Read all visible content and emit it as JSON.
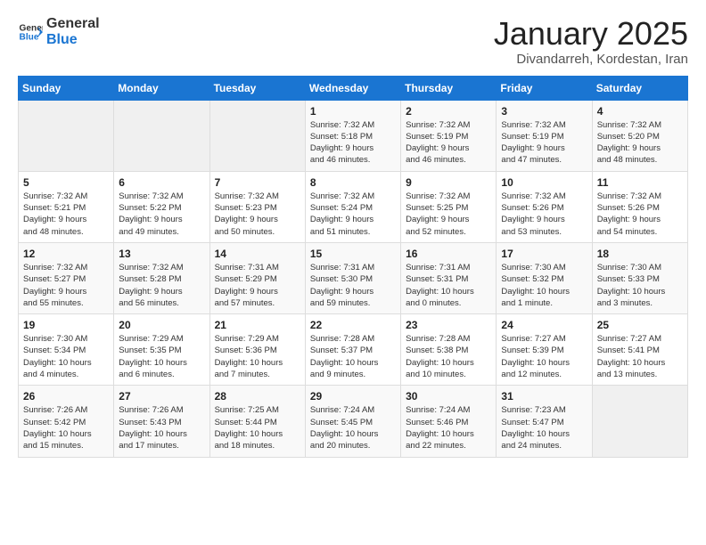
{
  "logo": {
    "line1": "General",
    "line2": "Blue"
  },
  "title": "January 2025",
  "subtitle": "Divandarreh, Kordestan, Iran",
  "weekdays": [
    "Sunday",
    "Monday",
    "Tuesday",
    "Wednesday",
    "Thursday",
    "Friday",
    "Saturday"
  ],
  "weeks": [
    [
      {
        "day": "",
        "empty": true
      },
      {
        "day": "",
        "empty": true
      },
      {
        "day": "",
        "empty": true
      },
      {
        "day": "1",
        "info": "Sunrise: 7:32 AM\nSunset: 5:18 PM\nDaylight: 9 hours\nand 46 minutes."
      },
      {
        "day": "2",
        "info": "Sunrise: 7:32 AM\nSunset: 5:19 PM\nDaylight: 9 hours\nand 46 minutes."
      },
      {
        "day": "3",
        "info": "Sunrise: 7:32 AM\nSunset: 5:19 PM\nDaylight: 9 hours\nand 47 minutes."
      },
      {
        "day": "4",
        "info": "Sunrise: 7:32 AM\nSunset: 5:20 PM\nDaylight: 9 hours\nand 48 minutes."
      }
    ],
    [
      {
        "day": "5",
        "info": "Sunrise: 7:32 AM\nSunset: 5:21 PM\nDaylight: 9 hours\nand 48 minutes."
      },
      {
        "day": "6",
        "info": "Sunrise: 7:32 AM\nSunset: 5:22 PM\nDaylight: 9 hours\nand 49 minutes."
      },
      {
        "day": "7",
        "info": "Sunrise: 7:32 AM\nSunset: 5:23 PM\nDaylight: 9 hours\nand 50 minutes."
      },
      {
        "day": "8",
        "info": "Sunrise: 7:32 AM\nSunset: 5:24 PM\nDaylight: 9 hours\nand 51 minutes."
      },
      {
        "day": "9",
        "info": "Sunrise: 7:32 AM\nSunset: 5:25 PM\nDaylight: 9 hours\nand 52 minutes."
      },
      {
        "day": "10",
        "info": "Sunrise: 7:32 AM\nSunset: 5:26 PM\nDaylight: 9 hours\nand 53 minutes."
      },
      {
        "day": "11",
        "info": "Sunrise: 7:32 AM\nSunset: 5:26 PM\nDaylight: 9 hours\nand 54 minutes."
      }
    ],
    [
      {
        "day": "12",
        "info": "Sunrise: 7:32 AM\nSunset: 5:27 PM\nDaylight: 9 hours\nand 55 minutes."
      },
      {
        "day": "13",
        "info": "Sunrise: 7:32 AM\nSunset: 5:28 PM\nDaylight: 9 hours\nand 56 minutes."
      },
      {
        "day": "14",
        "info": "Sunrise: 7:31 AM\nSunset: 5:29 PM\nDaylight: 9 hours\nand 57 minutes."
      },
      {
        "day": "15",
        "info": "Sunrise: 7:31 AM\nSunset: 5:30 PM\nDaylight: 9 hours\nand 59 minutes."
      },
      {
        "day": "16",
        "info": "Sunrise: 7:31 AM\nSunset: 5:31 PM\nDaylight: 10 hours\nand 0 minutes."
      },
      {
        "day": "17",
        "info": "Sunrise: 7:30 AM\nSunset: 5:32 PM\nDaylight: 10 hours\nand 1 minute."
      },
      {
        "day": "18",
        "info": "Sunrise: 7:30 AM\nSunset: 5:33 PM\nDaylight: 10 hours\nand 3 minutes."
      }
    ],
    [
      {
        "day": "19",
        "info": "Sunrise: 7:30 AM\nSunset: 5:34 PM\nDaylight: 10 hours\nand 4 minutes."
      },
      {
        "day": "20",
        "info": "Sunrise: 7:29 AM\nSunset: 5:35 PM\nDaylight: 10 hours\nand 6 minutes."
      },
      {
        "day": "21",
        "info": "Sunrise: 7:29 AM\nSunset: 5:36 PM\nDaylight: 10 hours\nand 7 minutes."
      },
      {
        "day": "22",
        "info": "Sunrise: 7:28 AM\nSunset: 5:37 PM\nDaylight: 10 hours\nand 9 minutes."
      },
      {
        "day": "23",
        "info": "Sunrise: 7:28 AM\nSunset: 5:38 PM\nDaylight: 10 hours\nand 10 minutes."
      },
      {
        "day": "24",
        "info": "Sunrise: 7:27 AM\nSunset: 5:39 PM\nDaylight: 10 hours\nand 12 minutes."
      },
      {
        "day": "25",
        "info": "Sunrise: 7:27 AM\nSunset: 5:41 PM\nDaylight: 10 hours\nand 13 minutes."
      }
    ],
    [
      {
        "day": "26",
        "info": "Sunrise: 7:26 AM\nSunset: 5:42 PM\nDaylight: 10 hours\nand 15 minutes."
      },
      {
        "day": "27",
        "info": "Sunrise: 7:26 AM\nSunset: 5:43 PM\nDaylight: 10 hours\nand 17 minutes."
      },
      {
        "day": "28",
        "info": "Sunrise: 7:25 AM\nSunset: 5:44 PM\nDaylight: 10 hours\nand 18 minutes."
      },
      {
        "day": "29",
        "info": "Sunrise: 7:24 AM\nSunset: 5:45 PM\nDaylight: 10 hours\nand 20 minutes."
      },
      {
        "day": "30",
        "info": "Sunrise: 7:24 AM\nSunset: 5:46 PM\nDaylight: 10 hours\nand 22 minutes."
      },
      {
        "day": "31",
        "info": "Sunrise: 7:23 AM\nSunset: 5:47 PM\nDaylight: 10 hours\nand 24 minutes."
      },
      {
        "day": "",
        "empty": true
      }
    ]
  ]
}
